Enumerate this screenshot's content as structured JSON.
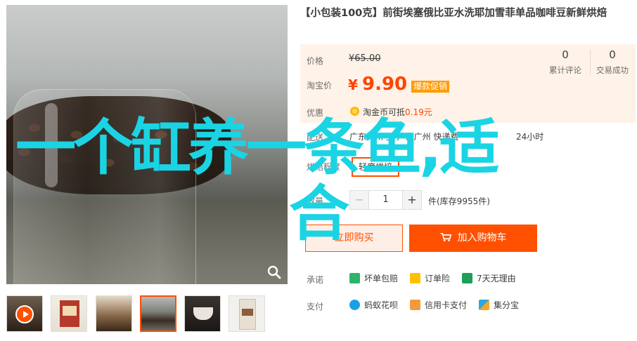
{
  "product": {
    "title": "【小包装100克】前街埃塞俄比亚水洗耶加雪菲单品咖啡豆新鲜烘焙"
  },
  "price": {
    "original_label": "价格",
    "original_value": "¥65.00",
    "taobao_label": "淘宝价",
    "currency": "¥",
    "taobao_value": "9.90",
    "promo_tag": "爆款促销"
  },
  "stats": {
    "reviews_count": "0",
    "reviews_label": "累计评论",
    "sales_count": "0",
    "sales_label": "交易成功"
  },
  "promo": {
    "label": "优惠",
    "text_prefix": "淘金币可抵",
    "text_value": "0.19元"
  },
  "shipping": {
    "label": "配送",
    "text": "广东广州 至 广东广州 快递费",
    "time": "24小时"
  },
  "roast": {
    "label": "烘焙程度",
    "option": "轻度烘焙"
  },
  "quantity": {
    "label": "数量",
    "minus": "−",
    "value": "1",
    "plus": "+",
    "stock": "件(库存9955件)"
  },
  "actions": {
    "buy_now": "立即购买",
    "add_to_cart": "加入购物车"
  },
  "promise": {
    "label": "承诺",
    "items": [
      "坏单包赔",
      "订单险",
      "7天无理由"
    ]
  },
  "payment": {
    "label": "支付",
    "items": [
      "蚂蚁花呗",
      "信用卡支付",
      "集分宝"
    ]
  },
  "overlay": {
    "line1": "一个缸养一条鱼,适",
    "line2": "合"
  },
  "colors": {
    "accent": "#ff5000",
    "price": "#ff4400",
    "overlay": "#1ad4e4",
    "price_bg": "#fff2e8"
  },
  "icons": [
    "search-icon",
    "play-icon",
    "gold-coin-icon",
    "cart-icon",
    "shield-icon",
    "order-insurance-icon",
    "seven-day-icon",
    "huabei-icon",
    "credit-card-icon",
    "jifenbao-icon"
  ]
}
